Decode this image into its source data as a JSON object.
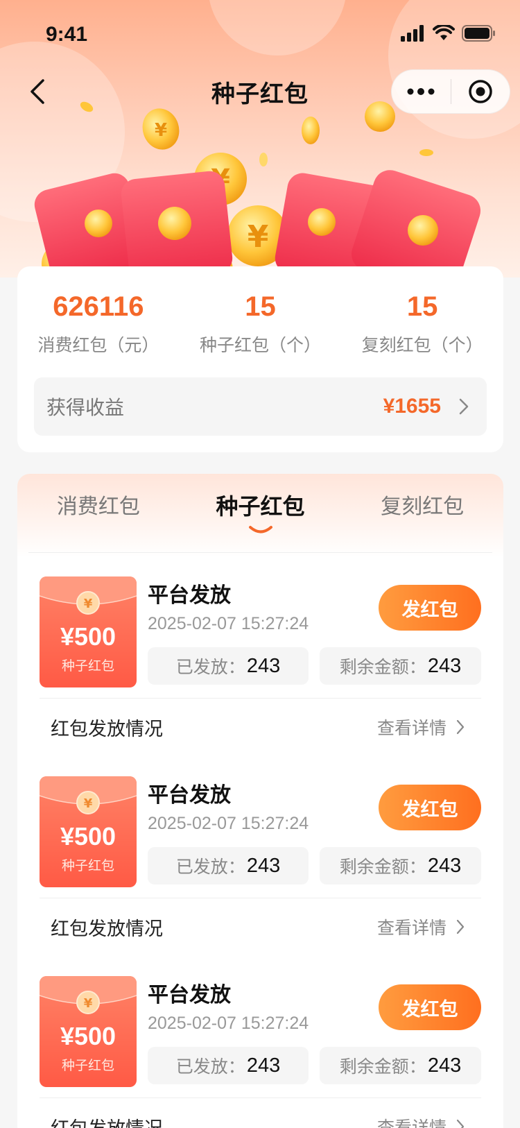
{
  "status_bar": {
    "time": "9:41"
  },
  "nav": {
    "title": "种子红包"
  },
  "stats": {
    "items": [
      {
        "value": "626116",
        "label": "消费红包（元）"
      },
      {
        "value": "15",
        "label": "种子红包（个）"
      },
      {
        "value": "15",
        "label": "复刻红包（个）"
      }
    ],
    "earnings": {
      "label": "获得收益",
      "value": "¥1655"
    }
  },
  "tabs": [
    {
      "label": "消费红包",
      "active": false
    },
    {
      "label": "种子红包",
      "active": true
    },
    {
      "label": "复刻红包",
      "active": false
    }
  ],
  "items": [
    {
      "amount": "¥500",
      "type": "种子红包",
      "coin_symbol": "¥",
      "title": "平台发放",
      "time": "2025-02-07 15:27:24",
      "button": "发红包",
      "sent_label": "已发放：",
      "sent_value": "243",
      "remaining_label": "剩余金额：",
      "remaining_value": "243",
      "footer_label": "红包发放情况",
      "footer_link": "查看详情"
    },
    {
      "amount": "¥500",
      "type": "种子红包",
      "coin_symbol": "¥",
      "title": "平台发放",
      "time": "2025-02-07 15:27:24",
      "button": "发红包",
      "sent_label": "已发放：",
      "sent_value": "243",
      "remaining_label": "剩余金额：",
      "remaining_value": "243",
      "footer_label": "红包发放情况",
      "footer_link": "查看详情"
    },
    {
      "amount": "¥500",
      "type": "种子红包",
      "coin_symbol": "¥",
      "title": "平台发放",
      "time": "2025-02-07 15:27:24",
      "button": "发红包",
      "sent_label": "已发放：",
      "sent_value": "243",
      "remaining_label": "剩余金额：",
      "remaining_value": "243",
      "footer_label": "红包发放情况",
      "footer_link": "查看详情"
    }
  ],
  "colors": {
    "accent": "#f4682a",
    "button": "#ff7a2a",
    "envelope": "#ff5a45"
  }
}
